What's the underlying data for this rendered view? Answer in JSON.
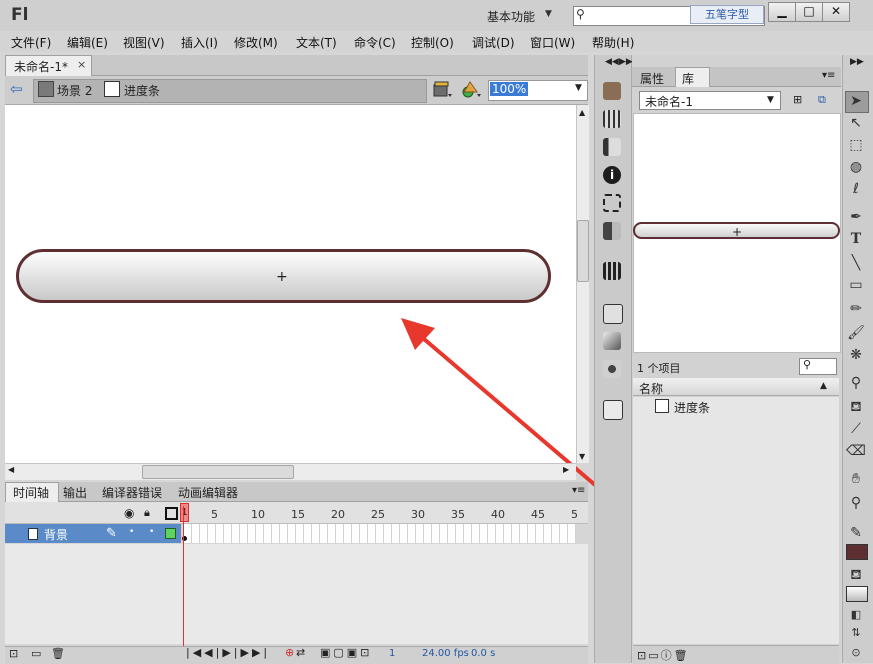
{
  "app": {
    "logo": "Fl",
    "workspace": "基本功能",
    "ime_badge": "五笔字型",
    "window_buttons": [
      "▁",
      "□",
      "✕"
    ]
  },
  "menu": [
    "文件(F)",
    "编辑(E)",
    "视图(V)",
    "插入(I)",
    "修改(M)",
    "文本(T)",
    "命令(C)",
    "控制(O)",
    "调试(D)",
    "窗口(W)",
    "帮助(H)"
  ],
  "document": {
    "tab_label": "未命名-1*",
    "close_glyph": "×"
  },
  "editbar": {
    "scene_label": "场景 2",
    "symbol_label": "进度条",
    "zoom": "100%"
  },
  "stage": {
    "symbol_outline_color": "#5e2f32",
    "arrow_color": "#e8372c"
  },
  "timeline": {
    "tabs": [
      "时间轴",
      "输出",
      "编译器错误",
      "动画编辑器"
    ],
    "layer_name": "背景",
    "frame_numbers": [
      "5",
      "10",
      "15",
      "20",
      "25",
      "30",
      "35",
      "40",
      "45",
      "5"
    ],
    "current_frame": "1",
    "status_frame": "1",
    "fps": "24.00 fps",
    "time": "0.0 s"
  },
  "library": {
    "tabs": [
      "属性",
      "库"
    ],
    "document_select": "未命名-1",
    "item_count": "1 个项目",
    "column_name": "名称",
    "items": [
      "进度条"
    ]
  },
  "tools": [
    "selection-tool",
    "subselection-tool",
    "free-transform-tool",
    "3d-rotation-tool",
    "lasso-tool",
    "pen-tool",
    "text-tool",
    "line-tool",
    "rectangle-tool",
    "pencil-tool",
    "brush-tool",
    "deco-tool",
    "bone-tool",
    "paint-bucket-tool",
    "eyedropper-tool",
    "eraser-tool",
    "hand-tool",
    "zoom-tool"
  ]
}
